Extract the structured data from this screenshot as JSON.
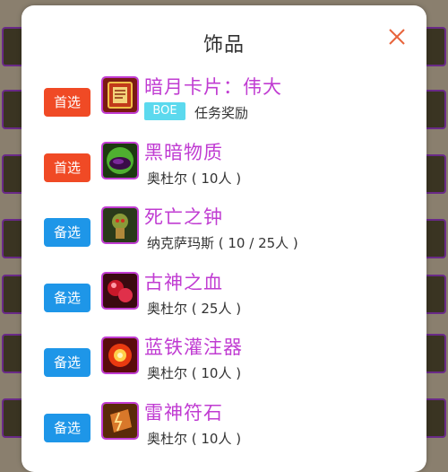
{
  "modal": {
    "title": "饰品"
  },
  "items": [
    {
      "tag": "首选",
      "tag_type": "primary",
      "name": "暗月卡片：伟大",
      "badge": "BOE",
      "source": "任务奖励",
      "icon": "darkmoon-card-icon"
    },
    {
      "tag": "首选",
      "tag_type": "primary",
      "name": "黑暗物质",
      "source": "奥杜尔 ( 10人 )",
      "icon": "dark-matter-icon"
    },
    {
      "tag": "备选",
      "tag_type": "backup",
      "name": "死亡之钟",
      "source": "纳克萨玛斯 ( 10 / 25人 )",
      "icon": "deaths-verdict-icon"
    },
    {
      "tag": "备选",
      "tag_type": "backup",
      "name": "古神之血",
      "source": "奥杜尔 ( 25人 )",
      "icon": "blood-of-old-god-icon"
    },
    {
      "tag": "备选",
      "tag_type": "backup",
      "name": "蓝铁灌注器",
      "source": "奥杜尔 ( 10人 )",
      "icon": "bluesteel-infuser-icon"
    },
    {
      "tag": "备选",
      "tag_type": "backup",
      "name": "雷神符石",
      "source": "奥杜尔 ( 10人 )",
      "icon": "thunder-rune-icon"
    }
  ],
  "colors": {
    "primary_tag": "#f04a25",
    "backup_tag": "#1e96e8",
    "item_name": "#c03cd2",
    "badge": "#5cd9ee"
  }
}
